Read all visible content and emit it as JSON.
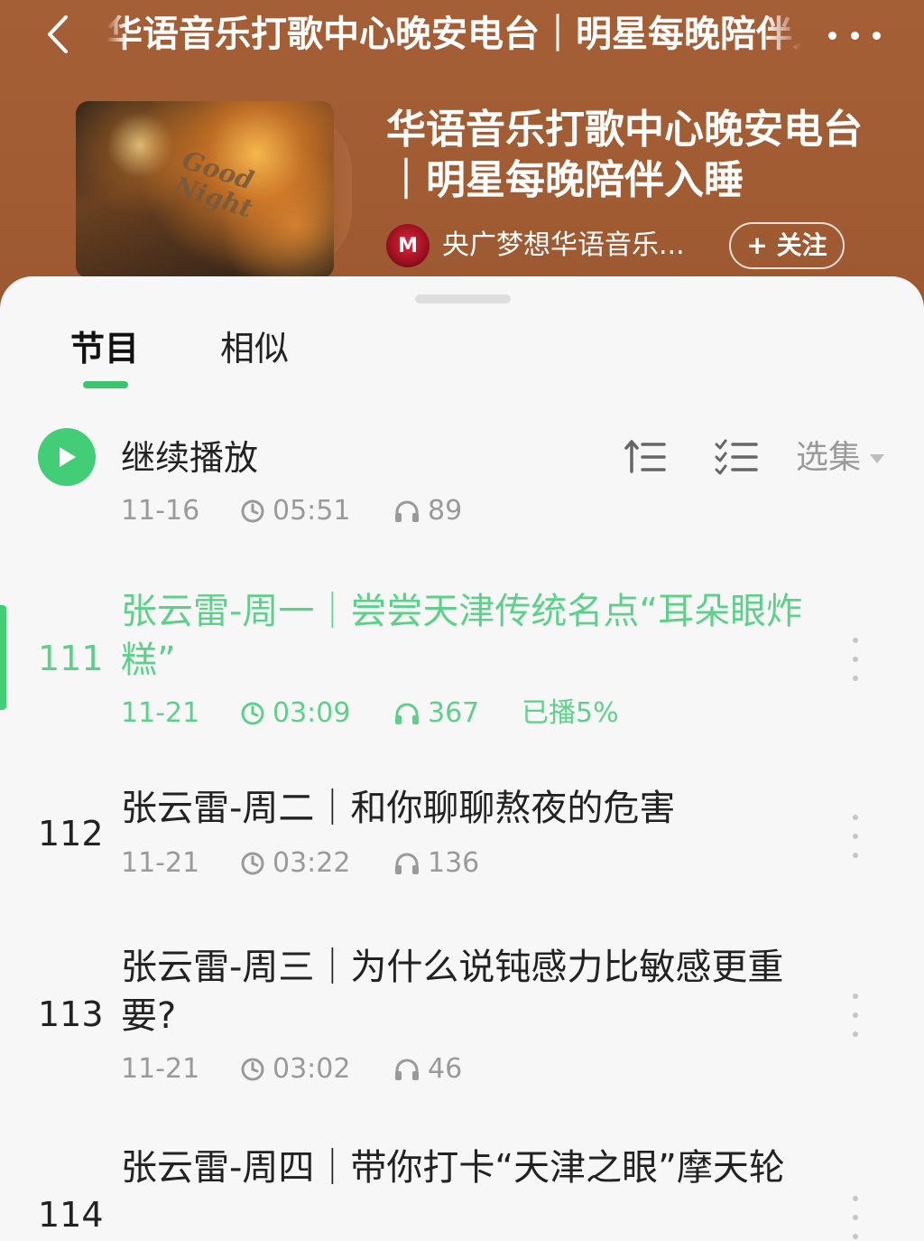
{
  "topbar": {
    "title": "华语音乐打歌中心晚安电台｜明星每晚陪伴入睡"
  },
  "album": {
    "cover_text": "Good Night",
    "title": "华语音乐打歌中心晚安电台｜明星每晚陪伴入睡",
    "author_name": "央广梦想华语音乐...",
    "follow_label": "+ 关注"
  },
  "tabs": [
    {
      "label": "节目",
      "active": true
    },
    {
      "label": "相似",
      "active": false
    }
  ],
  "resume": {
    "label": "继续播放",
    "date": "11-16",
    "duration": "05:51",
    "plays": "89"
  },
  "toolbar": {
    "episode_select_label": "选集"
  },
  "episodes": [
    {
      "index": "111",
      "title": "张云雷-周一｜尝尝天津传统名点“耳朵眼炸糕”",
      "date": "11-21",
      "duration": "03:09",
      "plays": "367",
      "progress": "已播5%",
      "playing": true
    },
    {
      "index": "112",
      "title": "张云雷-周二｜和你聊聊熬夜的危害",
      "date": "11-21",
      "duration": "03:22",
      "plays": "136",
      "playing": false
    },
    {
      "index": "113",
      "title": "张云雷-周三｜为什么说钝感力比敏感更重要?",
      "date": "11-21",
      "duration": "03:02",
      "plays": "46",
      "playing": false
    },
    {
      "index": "114",
      "title": "张云雷-周四｜带你打卡“天津之眼”摩天轮",
      "playing": false
    }
  ],
  "colors": {
    "header_brown": "#a15c33",
    "accent_green": "#43cd76",
    "playing_text": "#5fd08c",
    "muted_text": "#9a9a9a"
  }
}
